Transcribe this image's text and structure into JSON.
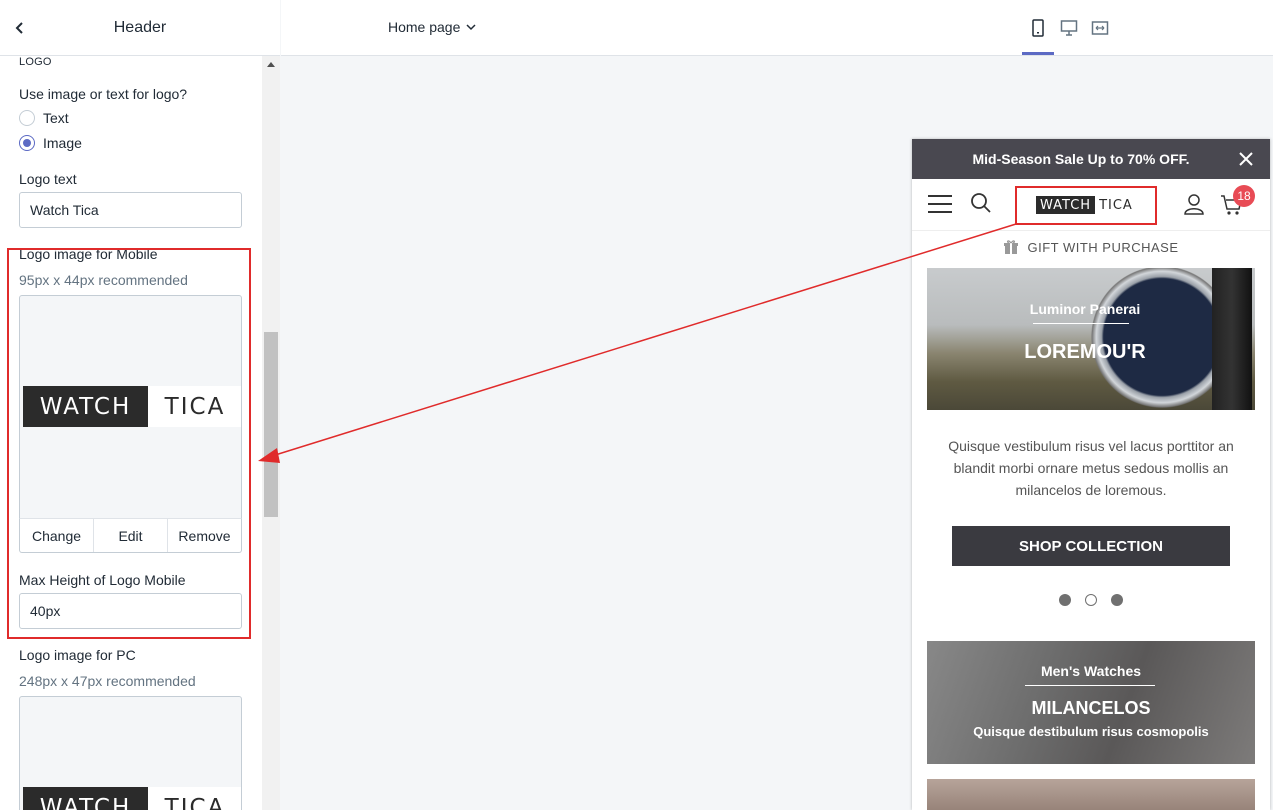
{
  "sidebar": {
    "title": "Header",
    "section_logo": "LOGO",
    "logo_type_question": "Use image or text for logo?",
    "logo_type_options": [
      {
        "label": "Text",
        "selected": false
      },
      {
        "label": "Image",
        "selected": true
      }
    ],
    "logo_text_label": "Logo text",
    "logo_text_value": "Watch Tica",
    "mobile_logo_label": "Logo image for Mobile",
    "mobile_logo_hint": "95px x 44px recommended",
    "logo_word_dark": "WATCH",
    "logo_word_light": "TICA",
    "image_actions": [
      "Change",
      "Edit",
      "Remove"
    ],
    "max_height_label": "Max Height of Logo Mobile",
    "max_height_value": "40px",
    "pc_logo_label": "Logo image for PC",
    "pc_logo_hint": "248px x 47px recommended"
  },
  "topbar": {
    "page_selector": "Home page",
    "devices": [
      "mobile-icon",
      "desktop-icon",
      "fullwidth-icon"
    ],
    "active_device": "mobile"
  },
  "preview": {
    "announcement": "Mid-Season Sale Up to 70% OFF.",
    "logo_dark": "WATCH",
    "logo_light": "TICA",
    "cart_count": "18",
    "gift_text": "GIFT WITH PURCHASE",
    "banner1_subtitle": "Luminor Panerai",
    "banner1_title": "LOREMOU'R",
    "description": "Quisque vestibulum risus vel lacus porttitor an blandit morbi ornare metus sedous mollis an milancelos de loremous.",
    "cta_label": "SHOP COLLECTION",
    "slides": 3,
    "active_slide": 2,
    "banner2_subtitle": "Men's Watches",
    "banner2_title": "MILANCELOS",
    "banner2_desc": "Quisque destibulum risus cosmopolis"
  },
  "colors": {
    "accent": "#5c6ac4",
    "annotation_red": "#e02b2b",
    "announcement_bg": "#494850",
    "badge": "#e84b55"
  }
}
